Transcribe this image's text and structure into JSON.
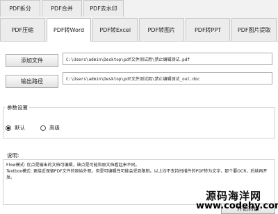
{
  "tabs_row1": [
    "PDF拆分",
    "PDF合并",
    "PDF去水印"
  ],
  "tabs_row2": [
    "PDF压缩",
    "PDF转Word",
    "PDF转Excel",
    "PDF转图片",
    "PDF转PPT",
    "PDF图片提取"
  ],
  "active_tab": "PDF转Word",
  "add_file": {
    "button_label": "添加文件",
    "path": "C:\\Users\\admin\\Desktop\\pdf文件测试用\\禁止编辑测试.pdf"
  },
  "output_path": {
    "button_label": "输出路径",
    "path": "C:\\Users\\admin\\Desktop\\pdf文件测试用\\禁止编辑测试_out.doc"
  },
  "params": {
    "title": "参数设置",
    "options": [
      {
        "label": "默认",
        "selected": true
      },
      {
        "label": "高级",
        "selected": false
      }
    ]
  },
  "description": {
    "title": "说明:",
    "lines": [
      "Flow模式: 优点是输出的文档可编辑，缺点是可能和原文档看起来不同。",
      "Textbox模式: 更接近保留PDF文件的原始外观，但是可编辑性可能会受到限制。以上均不支持扫描件的PDF转为文字，那个要OCR，后续再开发。"
    ]
  },
  "start_button": "开始转换",
  "watermark": {
    "brand": "源码海洋网",
    "url": "www.codehy.com"
  }
}
